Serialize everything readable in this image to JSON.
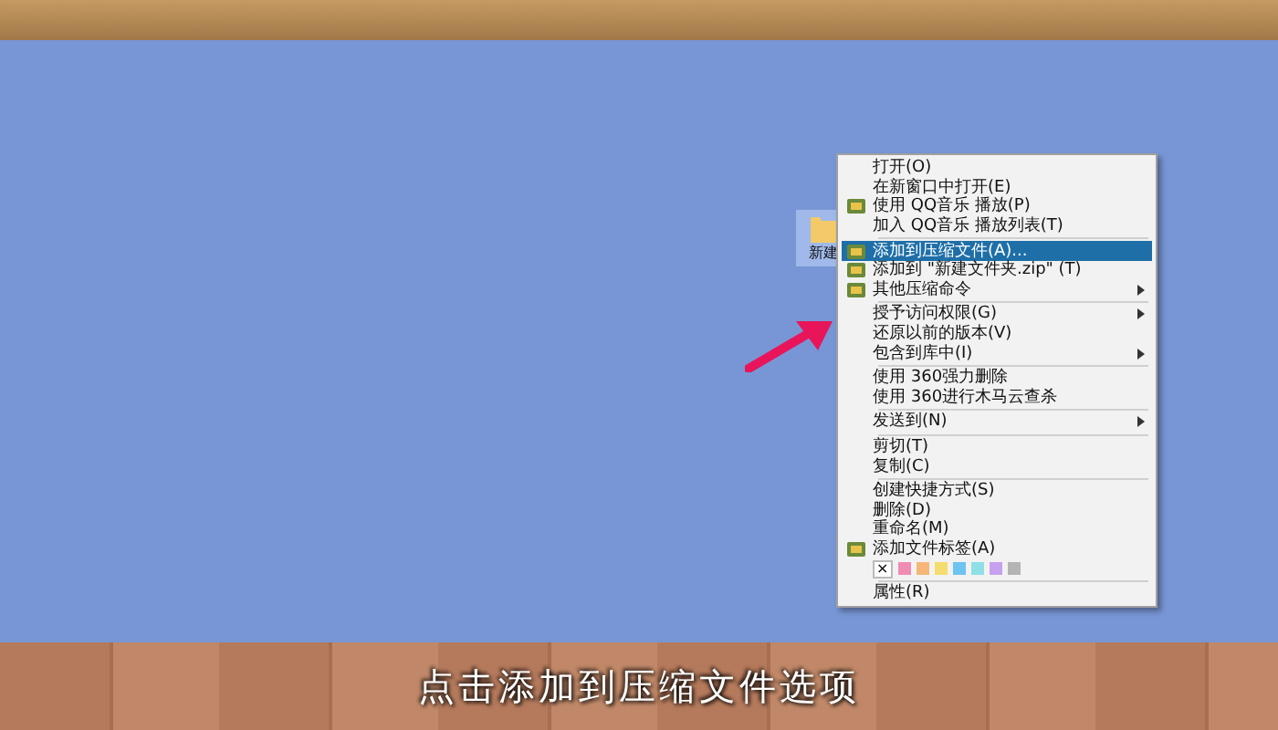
{
  "desktop": {
    "folder_label": "新建"
  },
  "context_menu": {
    "items": [
      {
        "kind": "item",
        "label": "打开(O)",
        "selected": false,
        "icon": false,
        "submenu": false
      },
      {
        "kind": "item",
        "label": "在新窗口中打开(E)",
        "selected": false,
        "icon": false,
        "submenu": false
      },
      {
        "kind": "item",
        "label": "使用 QQ音乐 播放(P)",
        "selected": false,
        "icon": true,
        "submenu": false
      },
      {
        "kind": "item",
        "label": "加入 QQ音乐 播放列表(T)",
        "selected": false,
        "icon": false,
        "submenu": false
      },
      {
        "kind": "separator"
      },
      {
        "kind": "item",
        "label": "添加到压缩文件(A)...",
        "selected": true,
        "icon": true,
        "submenu": false
      },
      {
        "kind": "item",
        "label": "添加到 \"新建文件夹.zip\" (T)",
        "selected": false,
        "icon": true,
        "submenu": false
      },
      {
        "kind": "item",
        "label": "其他压缩命令",
        "selected": false,
        "icon": true,
        "submenu": true
      },
      {
        "kind": "separator"
      },
      {
        "kind": "item",
        "label": "授予访问权限(G)",
        "selected": false,
        "icon": false,
        "submenu": true
      },
      {
        "kind": "item",
        "label": "还原以前的版本(V)",
        "selected": false,
        "icon": false,
        "submenu": false
      },
      {
        "kind": "item",
        "label": "包含到库中(I)",
        "selected": false,
        "icon": false,
        "submenu": true
      },
      {
        "kind": "separator"
      },
      {
        "kind": "item",
        "label": "使用 360强力删除",
        "selected": false,
        "icon": false,
        "submenu": false
      },
      {
        "kind": "item",
        "label": "使用 360进行木马云查杀",
        "selected": false,
        "icon": false,
        "submenu": false
      },
      {
        "kind": "separator"
      },
      {
        "kind": "item",
        "label": "发送到(N)",
        "selected": false,
        "icon": false,
        "submenu": true
      },
      {
        "kind": "separator"
      },
      {
        "kind": "item",
        "label": "剪切(T)",
        "selected": false,
        "icon": false,
        "submenu": false
      },
      {
        "kind": "item",
        "label": "复制(C)",
        "selected": false,
        "icon": false,
        "submenu": false
      },
      {
        "kind": "separator"
      },
      {
        "kind": "item",
        "label": "创建快捷方式(S)",
        "selected": false,
        "icon": false,
        "submenu": false
      },
      {
        "kind": "item",
        "label": "删除(D)",
        "selected": false,
        "icon": false,
        "submenu": false
      },
      {
        "kind": "item",
        "label": "重命名(M)",
        "selected": false,
        "icon": false,
        "submenu": false
      },
      {
        "kind": "item",
        "label": "添加文件标签(A)",
        "selected": false,
        "icon": true,
        "submenu": false
      },
      {
        "kind": "colors",
        "clear": "×",
        "colors": [
          {
            "color": "#f08cb4"
          },
          {
            "color": "#f5b678"
          },
          {
            "color": "#f5dc6e"
          },
          {
            "color": "#6ec3f0"
          },
          {
            "color": "#8ee0e6"
          },
          {
            "color": "#c8a0f0"
          },
          {
            "color": "#b4b4b4"
          }
        ]
      },
      {
        "kind": "separator"
      },
      {
        "kind": "item",
        "label": "属性(R)",
        "selected": false,
        "icon": false,
        "submenu": false
      }
    ]
  },
  "caption": "点击添加到压缩文件选项"
}
